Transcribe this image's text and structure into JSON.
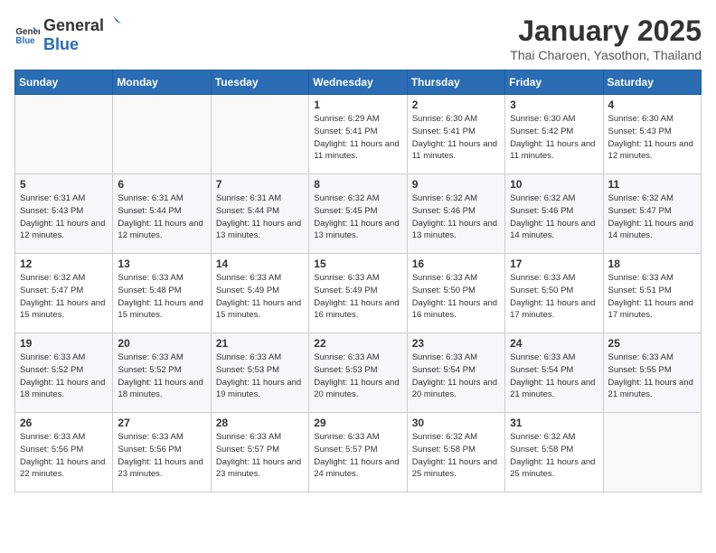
{
  "logo": {
    "general": "General",
    "blue": "Blue"
  },
  "title": "January 2025",
  "subtitle": "Thai Charoen, Yasothon, Thailand",
  "weekdays": [
    "Sunday",
    "Monday",
    "Tuesday",
    "Wednesday",
    "Thursday",
    "Friday",
    "Saturday"
  ],
  "weeks": [
    [
      {
        "day": "",
        "sunrise": "",
        "sunset": "",
        "daylight": ""
      },
      {
        "day": "",
        "sunrise": "",
        "sunset": "",
        "daylight": ""
      },
      {
        "day": "",
        "sunrise": "",
        "sunset": "",
        "daylight": ""
      },
      {
        "day": "1",
        "sunrise": "Sunrise: 6:29 AM",
        "sunset": "Sunset: 5:41 PM",
        "daylight": "Daylight: 11 hours and 11 minutes."
      },
      {
        "day": "2",
        "sunrise": "Sunrise: 6:30 AM",
        "sunset": "Sunset: 5:41 PM",
        "daylight": "Daylight: 11 hours and 11 minutes."
      },
      {
        "day": "3",
        "sunrise": "Sunrise: 6:30 AM",
        "sunset": "Sunset: 5:42 PM",
        "daylight": "Daylight: 11 hours and 11 minutes."
      },
      {
        "day": "4",
        "sunrise": "Sunrise: 6:30 AM",
        "sunset": "Sunset: 5:43 PM",
        "daylight": "Daylight: 11 hours and 12 minutes."
      }
    ],
    [
      {
        "day": "5",
        "sunrise": "Sunrise: 6:31 AM",
        "sunset": "Sunset: 5:43 PM",
        "daylight": "Daylight: 11 hours and 12 minutes."
      },
      {
        "day": "6",
        "sunrise": "Sunrise: 6:31 AM",
        "sunset": "Sunset: 5:44 PM",
        "daylight": "Daylight: 11 hours and 12 minutes."
      },
      {
        "day": "7",
        "sunrise": "Sunrise: 6:31 AM",
        "sunset": "Sunset: 5:44 PM",
        "daylight": "Daylight: 11 hours and 13 minutes."
      },
      {
        "day": "8",
        "sunrise": "Sunrise: 6:32 AM",
        "sunset": "Sunset: 5:45 PM",
        "daylight": "Daylight: 11 hours and 13 minutes."
      },
      {
        "day": "9",
        "sunrise": "Sunrise: 6:32 AM",
        "sunset": "Sunset: 5:46 PM",
        "daylight": "Daylight: 11 hours and 13 minutes."
      },
      {
        "day": "10",
        "sunrise": "Sunrise: 6:32 AM",
        "sunset": "Sunset: 5:46 PM",
        "daylight": "Daylight: 11 hours and 14 minutes."
      },
      {
        "day": "11",
        "sunrise": "Sunrise: 6:32 AM",
        "sunset": "Sunset: 5:47 PM",
        "daylight": "Daylight: 11 hours and 14 minutes."
      }
    ],
    [
      {
        "day": "12",
        "sunrise": "Sunrise: 6:32 AM",
        "sunset": "Sunset: 5:47 PM",
        "daylight": "Daylight: 11 hours and 15 minutes."
      },
      {
        "day": "13",
        "sunrise": "Sunrise: 6:33 AM",
        "sunset": "Sunset: 5:48 PM",
        "daylight": "Daylight: 11 hours and 15 minutes."
      },
      {
        "day": "14",
        "sunrise": "Sunrise: 6:33 AM",
        "sunset": "Sunset: 5:49 PM",
        "daylight": "Daylight: 11 hours and 15 minutes."
      },
      {
        "day": "15",
        "sunrise": "Sunrise: 6:33 AM",
        "sunset": "Sunset: 5:49 PM",
        "daylight": "Daylight: 11 hours and 16 minutes."
      },
      {
        "day": "16",
        "sunrise": "Sunrise: 6:33 AM",
        "sunset": "Sunset: 5:50 PM",
        "daylight": "Daylight: 11 hours and 16 minutes."
      },
      {
        "day": "17",
        "sunrise": "Sunrise: 6:33 AM",
        "sunset": "Sunset: 5:50 PM",
        "daylight": "Daylight: 11 hours and 17 minutes."
      },
      {
        "day": "18",
        "sunrise": "Sunrise: 6:33 AM",
        "sunset": "Sunset: 5:51 PM",
        "daylight": "Daylight: 11 hours and 17 minutes."
      }
    ],
    [
      {
        "day": "19",
        "sunrise": "Sunrise: 6:33 AM",
        "sunset": "Sunset: 5:52 PM",
        "daylight": "Daylight: 11 hours and 18 minutes."
      },
      {
        "day": "20",
        "sunrise": "Sunrise: 6:33 AM",
        "sunset": "Sunset: 5:52 PM",
        "daylight": "Daylight: 11 hours and 18 minutes."
      },
      {
        "day": "21",
        "sunrise": "Sunrise: 6:33 AM",
        "sunset": "Sunset: 5:53 PM",
        "daylight": "Daylight: 11 hours and 19 minutes."
      },
      {
        "day": "22",
        "sunrise": "Sunrise: 6:33 AM",
        "sunset": "Sunset: 5:53 PM",
        "daylight": "Daylight: 11 hours and 20 minutes."
      },
      {
        "day": "23",
        "sunrise": "Sunrise: 6:33 AM",
        "sunset": "Sunset: 5:54 PM",
        "daylight": "Daylight: 11 hours and 20 minutes."
      },
      {
        "day": "24",
        "sunrise": "Sunrise: 6:33 AM",
        "sunset": "Sunset: 5:54 PM",
        "daylight": "Daylight: 11 hours and 21 minutes."
      },
      {
        "day": "25",
        "sunrise": "Sunrise: 6:33 AM",
        "sunset": "Sunset: 5:55 PM",
        "daylight": "Daylight: 11 hours and 21 minutes."
      }
    ],
    [
      {
        "day": "26",
        "sunrise": "Sunrise: 6:33 AM",
        "sunset": "Sunset: 5:56 PM",
        "daylight": "Daylight: 11 hours and 22 minutes."
      },
      {
        "day": "27",
        "sunrise": "Sunrise: 6:33 AM",
        "sunset": "Sunset: 5:56 PM",
        "daylight": "Daylight: 11 hours and 23 minutes."
      },
      {
        "day": "28",
        "sunrise": "Sunrise: 6:33 AM",
        "sunset": "Sunset: 5:57 PM",
        "daylight": "Daylight: 11 hours and 23 minutes."
      },
      {
        "day": "29",
        "sunrise": "Sunrise: 6:33 AM",
        "sunset": "Sunset: 5:57 PM",
        "daylight": "Daylight: 11 hours and 24 minutes."
      },
      {
        "day": "30",
        "sunrise": "Sunrise: 6:32 AM",
        "sunset": "Sunset: 5:58 PM",
        "daylight": "Daylight: 11 hours and 25 minutes."
      },
      {
        "day": "31",
        "sunrise": "Sunrise: 6:32 AM",
        "sunset": "Sunset: 5:58 PM",
        "daylight": "Daylight: 11 hours and 25 minutes."
      },
      {
        "day": "",
        "sunrise": "",
        "sunset": "",
        "daylight": ""
      }
    ]
  ]
}
